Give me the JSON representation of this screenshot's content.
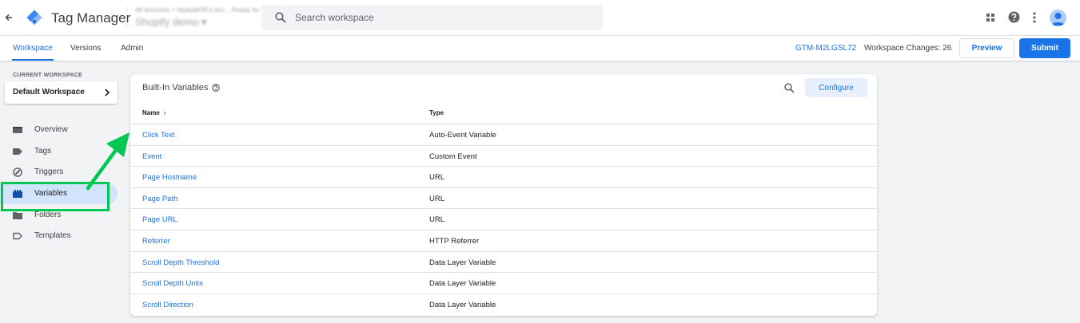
{
  "header": {
    "app_title": "Tag Manager",
    "account_line1": "All accounts > Vastu&#39;s Acc... Ready for",
    "account_line2": "Shopify demo ▾",
    "search_placeholder": "Search workspace"
  },
  "nav": {
    "tabs": [
      {
        "label": "Workspace",
        "active": true
      },
      {
        "label": "Versions",
        "active": false
      },
      {
        "label": "Admin",
        "active": false
      }
    ],
    "container_id": "GTM-M2LGSL72",
    "workspace_changes": "Workspace Changes: 26",
    "preview_label": "Preview",
    "submit_label": "Submit"
  },
  "sidebar": {
    "current_workspace_label": "CURRENT WORKSPACE",
    "workspace_name": "Default Workspace",
    "items": [
      {
        "label": "Overview",
        "icon": "overview-icon"
      },
      {
        "label": "Tags",
        "icon": "tag-icon"
      },
      {
        "label": "Triggers",
        "icon": "trigger-icon"
      },
      {
        "label": "Variables",
        "icon": "variables-icon",
        "active": true
      },
      {
        "label": "Folders",
        "icon": "folder-icon"
      },
      {
        "label": "Templates",
        "icon": "template-icon"
      }
    ]
  },
  "card": {
    "title": "Built-In Variables",
    "configure_label": "Configure",
    "columns": {
      "name": "Name",
      "type": "Type"
    },
    "rows": [
      {
        "name": "Click Text",
        "type": "Auto-Event Variable"
      },
      {
        "name": "Event",
        "type": "Custom Event"
      },
      {
        "name": "Page Hostname",
        "type": "URL"
      },
      {
        "name": "Page Path",
        "type": "URL"
      },
      {
        "name": "Page URL",
        "type": "URL"
      },
      {
        "name": "Referrer",
        "type": "HTTP Referrer"
      },
      {
        "name": "Scroll Depth Threshold",
        "type": "Data Layer Variable"
      },
      {
        "name": "Scroll Depth Units",
        "type": "Data Layer Variable"
      },
      {
        "name": "Scroll Direction",
        "type": "Data Layer Variable"
      }
    ]
  },
  "colors": {
    "accent": "#1a73e8",
    "active_nav_bg": "#d2e3fc",
    "annotation_green": "#00c853"
  }
}
